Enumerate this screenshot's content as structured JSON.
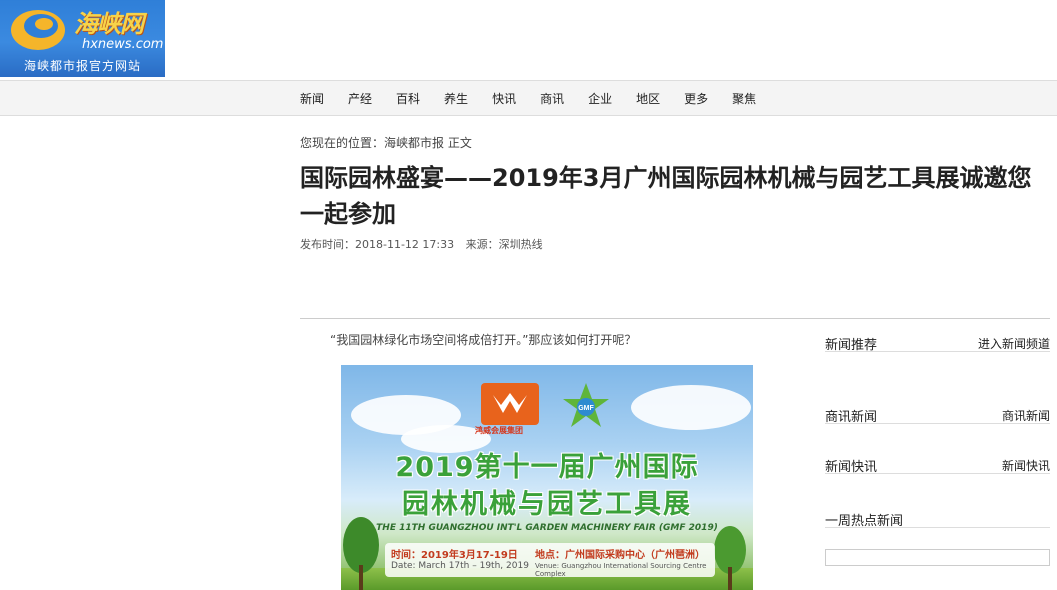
{
  "logo": {
    "brand_cn": "海峡网",
    "brand_en": "hxnews.com",
    "slogan": "海峡都市报官方网站",
    "colors": {
      "background": "#2f7fd8",
      "brand": "#f7d34a"
    }
  },
  "nav": {
    "items": [
      "新闻",
      "产经",
      "百科",
      "养生",
      "快讯",
      "商讯",
      "企业",
      "地区",
      "更多",
      "聚焦"
    ]
  },
  "breadcrumb": "您现在的位置：海峡都市报 正文",
  "article": {
    "title": "国际园林盛宴——2019年3月广州国际园林机械与园艺工具展诚邀您一起参加",
    "publish_time": "发布时间：2018-11-12 17:33",
    "source": "来源：深圳热线",
    "lead": "“我国园林绿化市场空间将成倍打开。”那应该如何打开呢？"
  },
  "banner": {
    "org_name": "鸿威会展集团",
    "gmf": "GMF",
    "title_line1": "2019第十一届广州国际",
    "title_line2": "园林机械与园艺工具展",
    "title_en": "THE 11TH GUANGZHOU INT'L GARDEN MACHINERY FAIR (GMF 2019)",
    "date": "时间：2019年3月17-19日",
    "date_en": "Date: March 17th – 19th, 2019",
    "venue": "地点：广州国际采购中心（广州琶洲）",
    "venue_en": "Venue: Guangzhou International Sourcing Centre Complex"
  },
  "sidebar": {
    "news_recommend": {
      "heading": "新闻推荐",
      "link": "进入新闻频道"
    },
    "business_news": {
      "heading": "商讯新闻",
      "link": "商讯新闻"
    },
    "news_flash": {
      "heading": "新闻快讯",
      "link": "新闻快讯"
    },
    "weekly_hot": {
      "heading": "一周热点新闻"
    }
  }
}
